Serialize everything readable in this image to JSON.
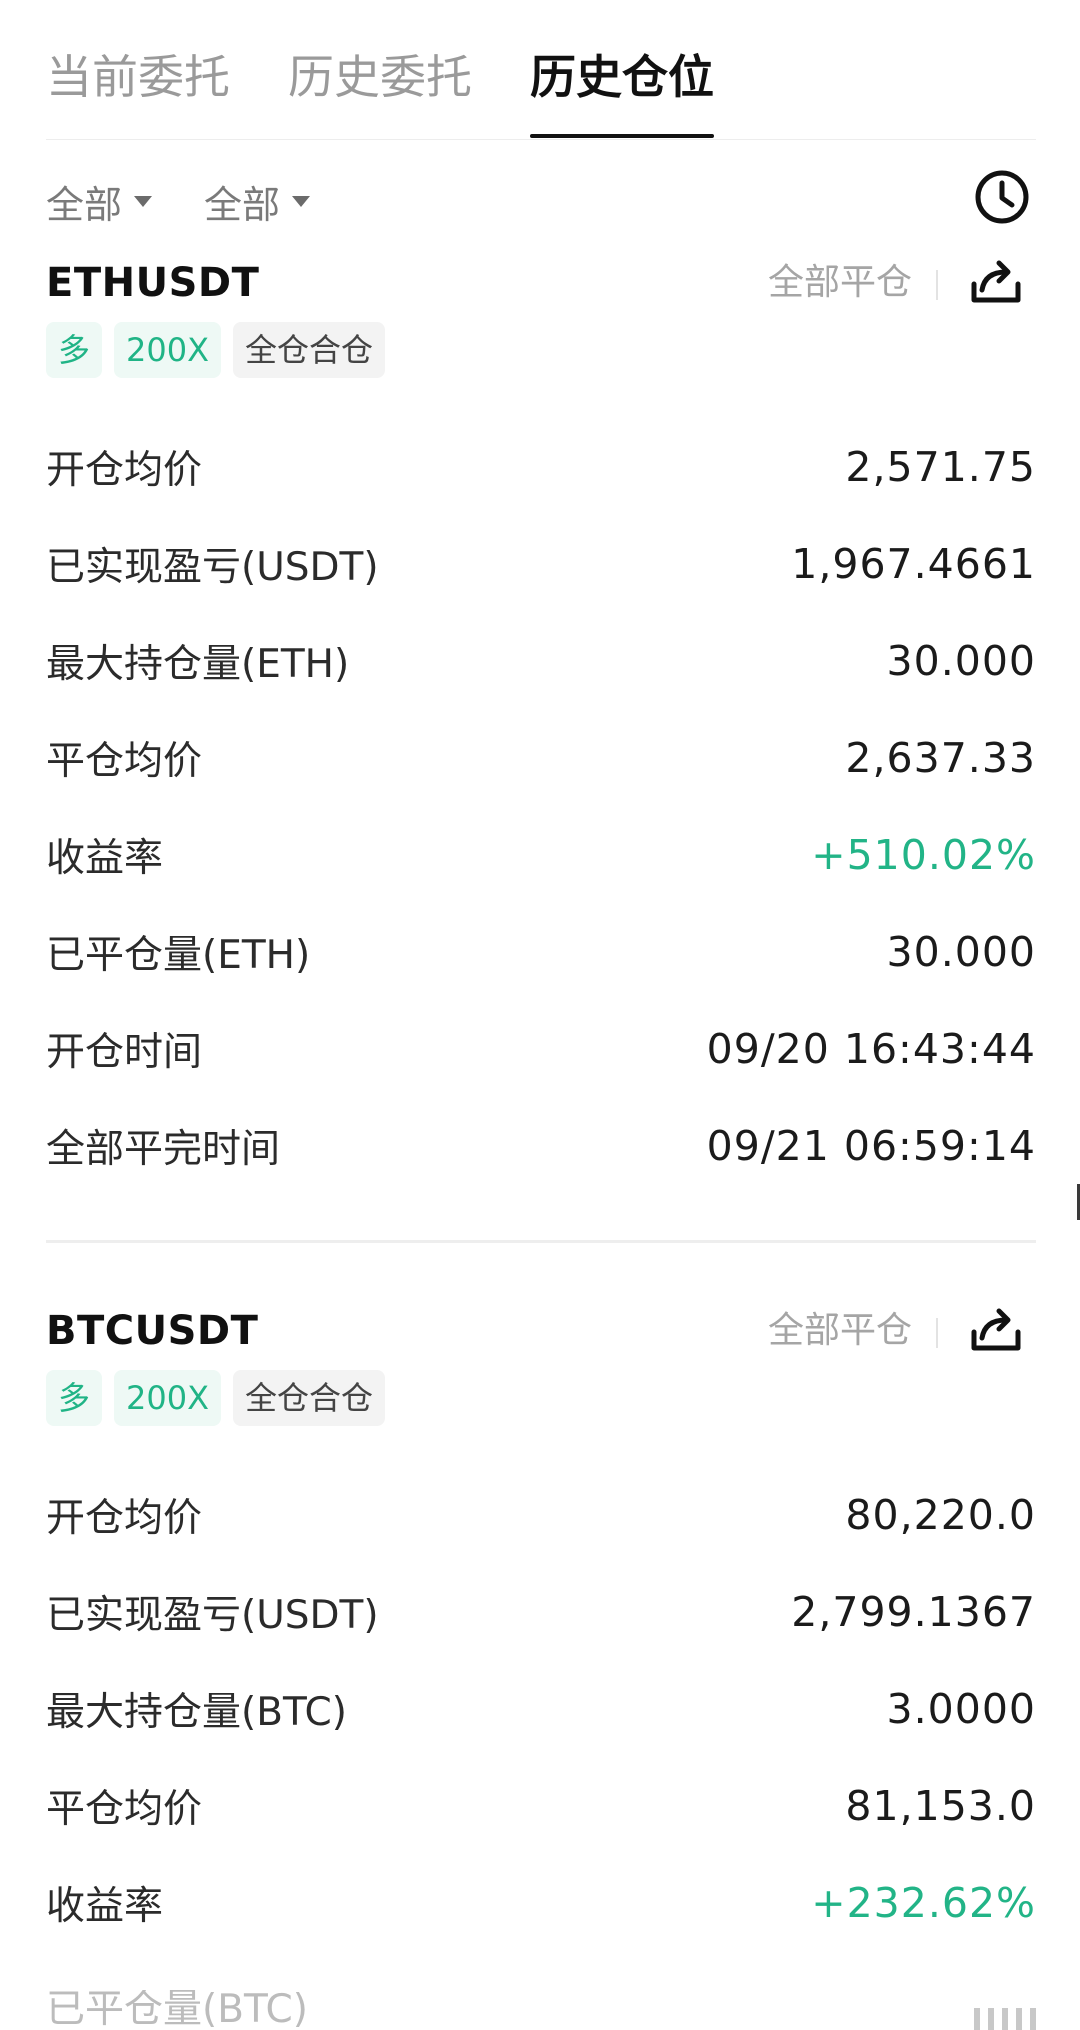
{
  "tabs": [
    {
      "label": "当前委托",
      "active": false
    },
    {
      "label": "历史委托",
      "active": false
    },
    {
      "label": "历史仓位",
      "active": true
    }
  ],
  "filters": {
    "filter1": "全部",
    "filter2": "全部",
    "clock_icon": "clock-icon"
  },
  "positions": [
    {
      "symbol": "ETHUSDT",
      "close_all_label": "全部平仓",
      "share_icon": "share-icon",
      "tags": {
        "side": "多",
        "leverage": "200X",
        "margin_mode": "全仓合仓"
      },
      "rows": [
        {
          "label": "开仓均价",
          "value": "2,571.75"
        },
        {
          "label": "已实现盈亏(USDT)",
          "value": "1,967.4661"
        },
        {
          "label": "最大持仓量(ETH)",
          "value": "30.000"
        },
        {
          "label": "平仓均价",
          "value": "2,637.33"
        },
        {
          "label": "收益率",
          "value": "+510.02%"
        },
        {
          "label": "已平仓量(ETH)",
          "value": "30.000"
        },
        {
          "label": "开仓时间",
          "value": "09/20 16:43:44"
        },
        {
          "label": "全部平完时间",
          "value": "09/21 06:59:14"
        }
      ]
    },
    {
      "symbol": "BTCUSDT",
      "close_all_label": "全部平仓",
      "share_icon": "share-icon",
      "tags": {
        "side": "多",
        "leverage": "200X",
        "margin_mode": "全仓合仓"
      },
      "rows": [
        {
          "label": "开仓均价",
          "value": "80,220.0"
        },
        {
          "label": "已实现盈亏(USDT)",
          "value": "2,799.1367"
        },
        {
          "label": "最大持仓量(BTC)",
          "value": "3.0000"
        },
        {
          "label": "平仓均价",
          "value": "81,153.0"
        },
        {
          "label": "收益率",
          "value": "+232.62%"
        }
      ],
      "partial_row_label": "已平仓量(BTC)"
    }
  ],
  "colors": {
    "positive": "#22b487",
    "tag_bg": "#eef9f5",
    "text": "#1b1b1b",
    "muted": "#9a9a9a"
  }
}
